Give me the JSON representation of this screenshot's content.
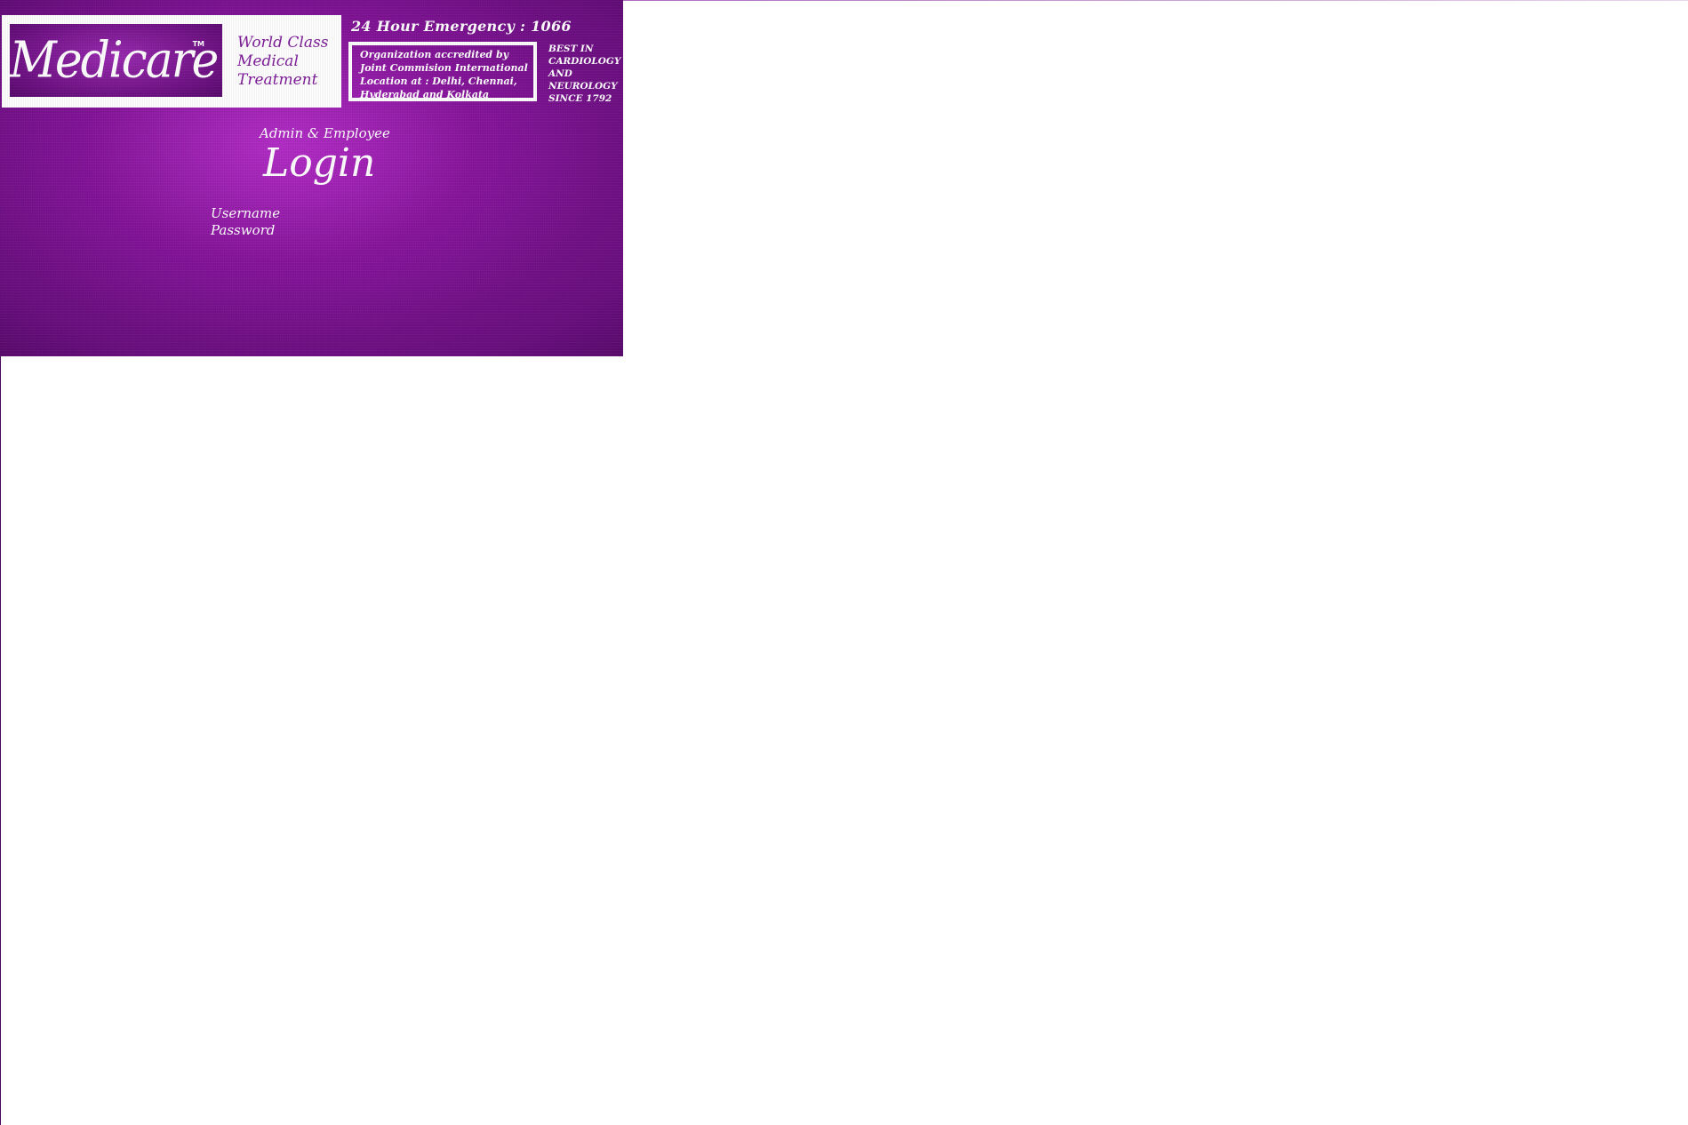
{
  "brand": {
    "logo_text": "Medicare",
    "trademark": "TM",
    "tagline": [
      "World Class",
      "Medical",
      "Treatment"
    ]
  },
  "header": {
    "emergency": "24 Hour Emergency : 1066",
    "accreditation": [
      "Organization accredited by",
      "Joint Commision International",
      "Location at : Delhi, Chennai,",
      "Hyderabad and Kolkata"
    ],
    "specialty": [
      "BEST IN",
      "CARDIOLOGY",
      "AND",
      "NEUROLOGY",
      "SINCE 1792"
    ]
  },
  "login": {
    "subtitle": "Admin & Employee",
    "title": "Login",
    "username_label": "Username",
    "username_value": "",
    "password_label": "Password",
    "password_value": ""
  },
  "colors": {
    "panel_purple": "#6a0e80",
    "accent_purple": "#7d1b98",
    "text": "#ffffff",
    "page_background": "#ffffff"
  }
}
